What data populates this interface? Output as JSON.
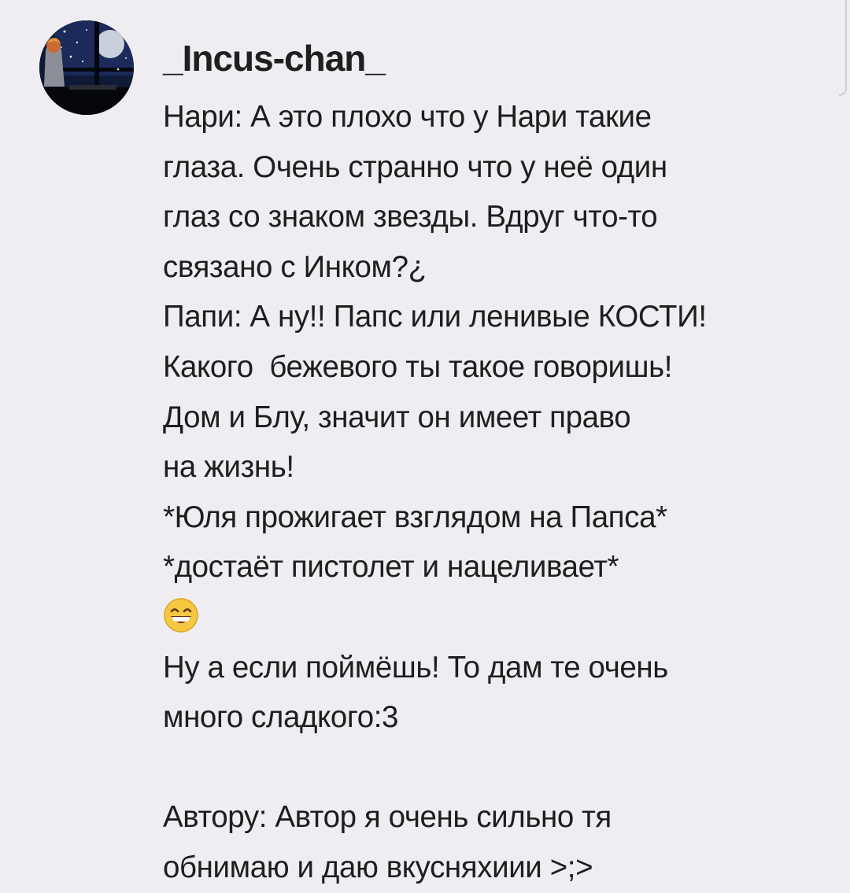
{
  "comment": {
    "author": "_Incus-chan_",
    "avatar_icon": "avatar-night-window-icon",
    "lines": [
      "Нари: А это плохо что у Нари такие",
      "глаза. Очень странно что у неё один",
      "глаз со знаком звезды. Вдруг что-то",
      "связано с Инком?¿",
      "Папи: А ну!! Папс или ленивые КОСТИ!",
      "Какого  бежевого ты такое говоришь!",
      "Дом и Блу, значит он имеет право",
      "на жизнь!",
      "*Юля прожигает взглядом на Папса*",
      "*достаёт пистолет и нацеливает*"
    ],
    "emoji_icon": "grinning-face-emoji-icon",
    "lines_after_emoji": [
      "Ну а если поймёшь! То дам те очень",
      "много сладкого:3"
    ],
    "lines_final": [
      "Автору: Автор я очень сильно тя",
      "обнимаю и даю вкусняхиии >;>"
    ]
  },
  "colors": {
    "background": "#efedf1",
    "text": "#1e1e1e",
    "emoji_face": "#f6c842"
  }
}
